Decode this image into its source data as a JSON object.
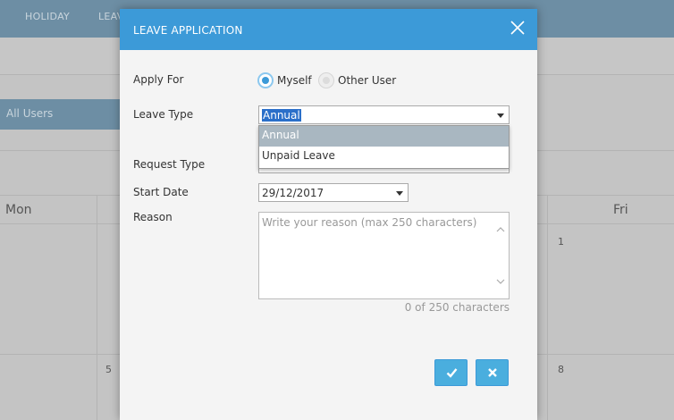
{
  "background": {
    "nav": [
      "HOLIDAY",
      "LEAV"
    ],
    "filter_label": "All Users",
    "weekdays": {
      "mon": "Mon",
      "fri": "Fri"
    },
    "day_numbers": [
      "1",
      "5",
      "8"
    ]
  },
  "modal": {
    "title": "LEAVE APPLICATION",
    "apply_for": {
      "label": "Apply For",
      "options": [
        "Myself",
        "Other User"
      ],
      "selected": "Myself"
    },
    "leave_type": {
      "label": "Leave Type",
      "value": "Annual",
      "options": [
        "Annual",
        "Unpaid Leave"
      ]
    },
    "request_type": {
      "label": "Request Type"
    },
    "start_date": {
      "label": "Start Date",
      "value": "29/12/2017"
    },
    "reason": {
      "label": "Reason",
      "placeholder": "Write your reason (max 250 characters)",
      "counter": "0 of 250 characters"
    }
  },
  "icons": {
    "close": "close-icon",
    "confirm": "checkmark-icon",
    "cancel": "x-icon",
    "scroll_up": "chevron-up-icon",
    "scroll_down": "chevron-down-icon"
  },
  "colors": {
    "header": "#3c9ad8",
    "button": "#4aaede",
    "dropdown_selected": "#a9b7c1"
  }
}
